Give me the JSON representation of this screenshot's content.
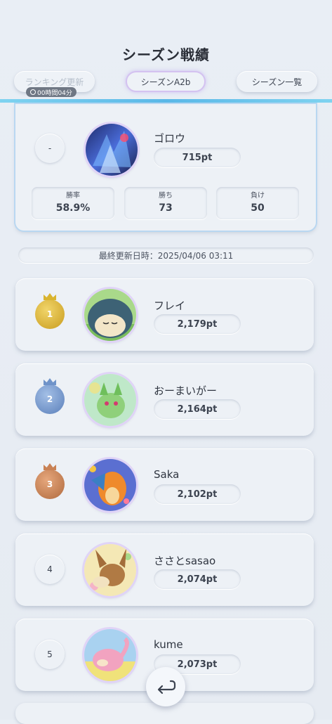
{
  "header": {
    "title": "シーズン戦績",
    "ranking_update_label": "ランキング更新",
    "timer_text": "00時間04分",
    "season_label": "シーズンA2b",
    "season_list_label": "シーズン一覧"
  },
  "my_record": {
    "rank": "-",
    "name": "ゴロウ",
    "points": "715pt",
    "win_rate_label": "勝率",
    "win_rate": "58.9%",
    "wins_label": "勝ち",
    "wins": "73",
    "losses_label": "負け",
    "losses": "50"
  },
  "last_updated": "最終更新日時：2025/04/06 03:11",
  "ranking": [
    {
      "rank": "1",
      "name": "フレイ",
      "points": "2,179pt"
    },
    {
      "rank": "2",
      "name": "おーまいがー",
      "points": "2,164pt"
    },
    {
      "rank": "3",
      "name": "Saka",
      "points": "2,102pt"
    },
    {
      "rank": "4",
      "name": "ささとsasao",
      "points": "2,074pt"
    },
    {
      "rank": "5",
      "name": "kume",
      "points": "2,073pt"
    }
  ],
  "colors": {
    "gold": "#d9b430",
    "silver_blue": "#6f93c9",
    "bronze": "#c98255",
    "accent_line": "#5ab8e8"
  },
  "icons": {
    "back": "return-arrow-icon",
    "timer": "clock-icon"
  }
}
